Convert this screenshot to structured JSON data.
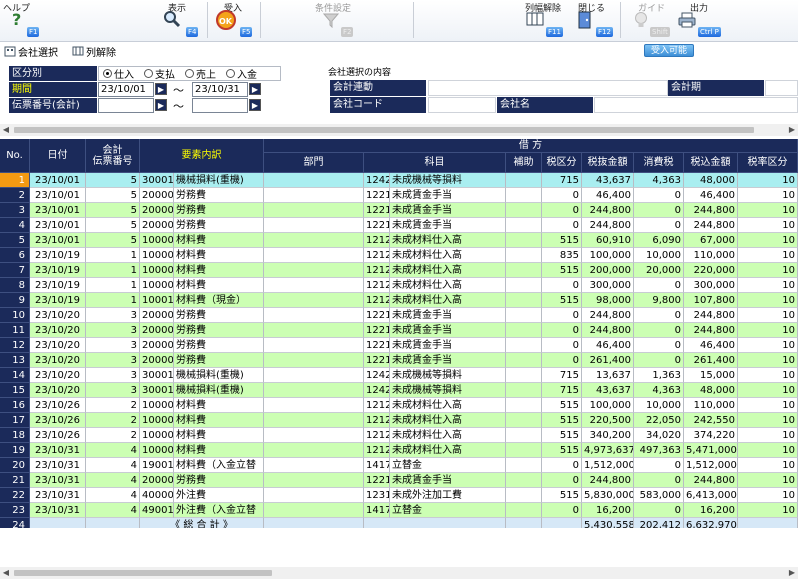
{
  "toolbar": {
    "help": {
      "label": "ヘルプ",
      "key": "F1"
    },
    "view": {
      "label": "表示",
      "key": "F4"
    },
    "receive": {
      "label": "受入",
      "key": "F5"
    },
    "conditions": {
      "label": "条件設定",
      "key": "F2"
    },
    "clear_columns": {
      "label": "列幅解除",
      "key": "F11"
    },
    "close": {
      "label": "閉じる",
      "key": "F12"
    },
    "guide": {
      "label": "ガイド",
      "key": "Shift"
    },
    "output": {
      "label": "出力",
      "key": "Ctrl P"
    }
  },
  "subbar": {
    "company_select": "会社選択",
    "column_release": "列解除",
    "accept_possible": "受入可能"
  },
  "filters": {
    "category_label": "区分別",
    "radios": [
      "仕入",
      "支払",
      "売上",
      "入金"
    ],
    "selected_radio": 0,
    "period_label": "期間",
    "period_from": "23/10/01",
    "period_to": "23/10/31",
    "voucher_label": "伝票番号(会計)",
    "voucher_from": "",
    "voucher_to": "",
    "tilde": "～"
  },
  "company_info": {
    "section_title": "会社選択の内容",
    "link_label": "会計連動",
    "link_value": "",
    "term_label": "会計期",
    "term_value": "",
    "code_label": "会社コード",
    "code_value": "",
    "name_label": "会社名",
    "name_value": ""
  },
  "grid": {
    "headers": {
      "no": "No.",
      "date": "日付",
      "voucher": "会計\n伝票番号",
      "element": "要素内訳",
      "debit": "借 方",
      "dept": "部門",
      "account": "科目",
      "sub": "補助",
      "tax_cat": "税区分",
      "ex_amount": "税抜金額",
      "tax": "消費税",
      "in_amount": "税込金額",
      "tax_rate": "税率区分"
    },
    "rows": [
      {
        "no": "1",
        "date": "23/10/01",
        "vno": "5",
        "ecode": "30001",
        "ename": "機械損料(重機)",
        "acode": "1242",
        "aname": "未成機械等損料",
        "tcat": "715",
        "ex": "43,637",
        "tax": "4,363",
        "inc": "48,000",
        "rate": "10"
      },
      {
        "no": "2",
        "date": "23/10/01",
        "vno": "5",
        "ecode": "20000",
        "ename": "労務費",
        "acode": "1221",
        "aname": "未成賃金手当",
        "tcat": "0",
        "ex": "46,400",
        "tax": "0",
        "inc": "46,400",
        "rate": "10"
      },
      {
        "no": "3",
        "date": "23/10/01",
        "vno": "5",
        "ecode": "20000",
        "ename": "労務費",
        "acode": "1221",
        "aname": "未成賃金手当",
        "tcat": "0",
        "ex": "244,800",
        "tax": "0",
        "inc": "244,800",
        "rate": "10"
      },
      {
        "no": "4",
        "date": "23/10/01",
        "vno": "5",
        "ecode": "20000",
        "ename": "労務費",
        "acode": "1221",
        "aname": "未成賃金手当",
        "tcat": "0",
        "ex": "244,800",
        "tax": "0",
        "inc": "244,800",
        "rate": "10"
      },
      {
        "no": "5",
        "date": "23/10/01",
        "vno": "5",
        "ecode": "10000",
        "ename": "材料費",
        "acode": "1212",
        "aname": "未成材料仕入高",
        "tcat": "515",
        "ex": "60,910",
        "tax": "6,090",
        "inc": "67,000",
        "rate": "10"
      },
      {
        "no": "6",
        "date": "23/10/19",
        "vno": "1",
        "ecode": "10000",
        "ename": "材料費",
        "acode": "1212",
        "aname": "未成材料仕入高",
        "tcat": "835",
        "ex": "100,000",
        "tax": "10,000",
        "inc": "110,000",
        "rate": "10"
      },
      {
        "no": "7",
        "date": "23/10/19",
        "vno": "1",
        "ecode": "10000",
        "ename": "材料費",
        "acode": "1212",
        "aname": "未成材料仕入高",
        "tcat": "515",
        "ex": "200,000",
        "tax": "20,000",
        "inc": "220,000",
        "rate": "10"
      },
      {
        "no": "8",
        "date": "23/10/19",
        "vno": "1",
        "ecode": "10000",
        "ename": "材料費",
        "acode": "1212",
        "aname": "未成材料仕入高",
        "tcat": "0",
        "ex": "300,000",
        "tax": "0",
        "inc": "300,000",
        "rate": "10"
      },
      {
        "no": "9",
        "date": "23/10/19",
        "vno": "1",
        "ecode": "10001",
        "ename": "材料費（現金）",
        "acode": "1212",
        "aname": "未成材料仕入高",
        "tcat": "515",
        "ex": "98,000",
        "tax": "9,800",
        "inc": "107,800",
        "rate": "10"
      },
      {
        "no": "10",
        "date": "23/10/20",
        "vno": "3",
        "ecode": "20000",
        "ename": "労務費",
        "acode": "1221",
        "aname": "未成賃金手当",
        "tcat": "0",
        "ex": "244,800",
        "tax": "0",
        "inc": "244,800",
        "rate": "10"
      },
      {
        "no": "11",
        "date": "23/10/20",
        "vno": "3",
        "ecode": "20000",
        "ename": "労務費",
        "acode": "1221",
        "aname": "未成賃金手当",
        "tcat": "0",
        "ex": "244,800",
        "tax": "0",
        "inc": "244,800",
        "rate": "10"
      },
      {
        "no": "12",
        "date": "23/10/20",
        "vno": "3",
        "ecode": "20000",
        "ename": "労務費",
        "acode": "1221",
        "aname": "未成賃金手当",
        "tcat": "0",
        "ex": "46,400",
        "tax": "0",
        "inc": "46,400",
        "rate": "10"
      },
      {
        "no": "13",
        "date": "23/10/20",
        "vno": "3",
        "ecode": "20000",
        "ename": "労務費",
        "acode": "1221",
        "aname": "未成賃金手当",
        "tcat": "0",
        "ex": "261,400",
        "tax": "0",
        "inc": "261,400",
        "rate": "10"
      },
      {
        "no": "14",
        "date": "23/10/20",
        "vno": "3",
        "ecode": "30001",
        "ename": "機械損料(重機)",
        "acode": "1242",
        "aname": "未成機械等損料",
        "tcat": "715",
        "ex": "13,637",
        "tax": "1,363",
        "inc": "15,000",
        "rate": "10"
      },
      {
        "no": "15",
        "date": "23/10/20",
        "vno": "3",
        "ecode": "30001",
        "ename": "機械損料(重機)",
        "acode": "1242",
        "aname": "未成機械等損料",
        "tcat": "715",
        "ex": "43,637",
        "tax": "4,363",
        "inc": "48,000",
        "rate": "10"
      },
      {
        "no": "16",
        "date": "23/10/26",
        "vno": "2",
        "ecode": "10000",
        "ename": "材料費",
        "acode": "1212",
        "aname": "未成材料仕入高",
        "tcat": "515",
        "ex": "100,000",
        "tax": "10,000",
        "inc": "110,000",
        "rate": "10"
      },
      {
        "no": "17",
        "date": "23/10/26",
        "vno": "2",
        "ecode": "10000",
        "ename": "材料費",
        "acode": "1212",
        "aname": "未成材料仕入高",
        "tcat": "515",
        "ex": "220,500",
        "tax": "22,050",
        "inc": "242,550",
        "rate": "10"
      },
      {
        "no": "18",
        "date": "23/10/26",
        "vno": "2",
        "ecode": "10000",
        "ename": "材料費",
        "acode": "1212",
        "aname": "未成材料仕入高",
        "tcat": "515",
        "ex": "340,200",
        "tax": "34,020",
        "inc": "374,220",
        "rate": "10"
      },
      {
        "no": "19",
        "date": "23/10/31",
        "vno": "4",
        "ecode": "10000",
        "ename": "材料費",
        "acode": "1212",
        "aname": "未成材料仕入高",
        "tcat": "515",
        "ex": "4,973,637",
        "tax": "497,363",
        "inc": "5,471,000",
        "rate": "10"
      },
      {
        "no": "20",
        "date": "23/10/31",
        "vno": "4",
        "ecode": "19001",
        "ename": "材料費（入金立替",
        "acode": "1417",
        "aname": "立替金",
        "tcat": "0",
        "ex": "1,512,000",
        "tax": "0",
        "inc": "1,512,000",
        "rate": "10"
      },
      {
        "no": "21",
        "date": "23/10/31",
        "vno": "4",
        "ecode": "20000",
        "ename": "労務費",
        "acode": "1221",
        "aname": "未成賃金手当",
        "tcat": "0",
        "ex": "244,800",
        "tax": "0",
        "inc": "244,800",
        "rate": "10"
      },
      {
        "no": "22",
        "date": "23/10/31",
        "vno": "4",
        "ecode": "40000",
        "ename": "外注費",
        "acode": "1231",
        "aname": "未成外注加工費",
        "tcat": "515",
        "ex": "5,830,000",
        "tax": "583,000",
        "inc": "6,413,000",
        "rate": "10"
      },
      {
        "no": "23",
        "date": "23/10/31",
        "vno": "4",
        "ecode": "49001",
        "ename": "外注費（入金立替",
        "acode": "1417",
        "aname": "立替金",
        "tcat": "0",
        "ex": "16,200",
        "tax": "0",
        "inc": "16,200",
        "rate": "10"
      }
    ],
    "total": {
      "no": "24",
      "label": "《 総 合 計 》",
      "ex": "5,430,558",
      "tax": "202,412",
      "inc": "6,632,970"
    },
    "selected_row": 0
  },
  "colors": {
    "header_bg": "#1b2a5a",
    "row_even": "#ccffb3",
    "selected_no": "#f39a12",
    "selected_row": "#a9eef0",
    "label_yellow": "#ffff00"
  },
  "icons": {
    "help": "question-icon",
    "view": "magnifier-icon",
    "receive": "ok-badge-icon",
    "conditions": "filter-icon",
    "clear_columns": "columns-icon",
    "close": "door-icon",
    "guide": "bulb-icon",
    "output": "printer-icon"
  }
}
